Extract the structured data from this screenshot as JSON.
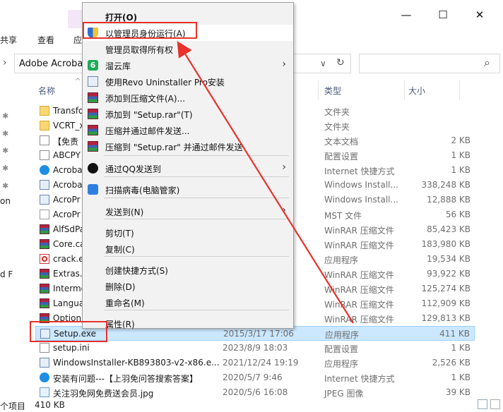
{
  "ribbon": {
    "tabs": [
      "共享",
      "查看",
      "应"
    ]
  },
  "window_controls": {
    "minimize": "—",
    "maximize": "☐",
    "close": "✕"
  },
  "address": {
    "path": "Adobe Acrobat",
    "dropdown": "∨",
    "refresh": "↻",
    "search_icon": "⌕"
  },
  "columns": {
    "name": "名称",
    "type": "类型",
    "size": "大小",
    "sort_arrow": "^"
  },
  "left_clipped": [
    "on",
    "d F"
  ],
  "files": [
    {
      "name": "Transfo",
      "date": "",
      "type": "文件夹",
      "size": "",
      "icon": "folder-icon"
    },
    {
      "name": "VCRT_x",
      "date": "",
      "type": "文件夹",
      "size": "",
      "icon": "folder-icon"
    },
    {
      "name": "【免责",
      "date": "",
      "type": "文本文档",
      "size": "2 KB",
      "icon": "text-file-icon"
    },
    {
      "name": "ABCPY",
      "date": "",
      "type": "配置设置",
      "size": "1 KB",
      "icon": "config-file-icon"
    },
    {
      "name": "Acroba",
      "date": "",
      "type": "Internet 快捷方式",
      "size": "1 KB",
      "icon": "internet-shortcut-icon"
    },
    {
      "name": "Acroba",
      "date": "",
      "type": "Windows Install...",
      "size": "338,248 KB",
      "icon": "installer-icon"
    },
    {
      "name": "AcroPr",
      "date": "",
      "type": "Windows Install...",
      "size": "12,888 KB",
      "icon": "installer-icon"
    },
    {
      "name": "AcroPr",
      "date": "",
      "type": "MST 文件",
      "size": "56 KB",
      "icon": "mst-file-icon"
    },
    {
      "name": "AlfSdPa",
      "date": "",
      "type": "WinRAR 压缩文件",
      "size": "85,423 KB",
      "icon": "winrar-icon"
    },
    {
      "name": "Core.ca",
      "date": "",
      "type": "WinRAR 压缩文件",
      "size": "183,980 KB",
      "icon": "winrar-icon"
    },
    {
      "name": "crack.e",
      "date": "",
      "type": "应用程序",
      "size": "19,534 KB",
      "icon": "pdf-app-icon"
    },
    {
      "name": "Extras.",
      "date": "",
      "type": "WinRAR 压缩文件",
      "size": "93,922 KB",
      "icon": "winrar-icon"
    },
    {
      "name": "Interme",
      "date": "",
      "type": "WinRAR 压缩文件",
      "size": "125,274 KB",
      "icon": "winrar-icon"
    },
    {
      "name": "Langua",
      "date": "",
      "type": "WinRAR 压缩文件",
      "size": "112,909 KB",
      "icon": "winrar-icon"
    },
    {
      "name": "Option",
      "date": "",
      "type": "WinRAR 压缩文件",
      "size": "129,813 KB",
      "icon": "winrar-icon"
    },
    {
      "name": "Setup.exe",
      "date": "2015/3/17 17:06",
      "type": "应用程序",
      "size": "411 KB",
      "icon": "setup-exe-icon"
    },
    {
      "name": "setup.ini",
      "date": "2023/8/9 18:03",
      "type": "配置设置",
      "size": "1 KB",
      "icon": "config-file-icon"
    },
    {
      "name": "WindowsInstaller-KB893803-v2-x86.e...",
      "date": "2021/12/24 19:19",
      "type": "应用程序",
      "size": "2,526 KB",
      "icon": "installer-app-icon"
    },
    {
      "name": "安装有问题---【上羽免问答搜索答案】",
      "date": "2020/5/7 9:46",
      "type": "Internet 快捷方式",
      "size": "1 KB",
      "icon": "internet-shortcut-icon"
    },
    {
      "name": "关注羽免网免费送会员.jpg",
      "date": "2020/5/6 16:08",
      "type": "JPEG 图像",
      "size": "39 KB",
      "icon": "jpeg-image-icon"
    }
  ],
  "status": {
    "count": "个项目",
    "selected": "410 KB"
  },
  "menu": {
    "items": [
      {
        "label": "打开(O)",
        "bold": true,
        "icon": "",
        "arrow": false
      },
      {
        "label": "以管理员身份运行(A)",
        "icon": "uac-shield-icon",
        "arrow": false,
        "highlight": true
      },
      {
        "label": "管理员取得所有权",
        "icon": "",
        "arrow": false
      },
      {
        "label": "溜云库",
        "icon": "liuyunku-icon",
        "glyph": "6",
        "arrow": true
      },
      {
        "label": "使用Revo Uninstaller Pro安装",
        "icon": "revo-uninstaller-icon",
        "arrow": false
      },
      {
        "label": "添加到压缩文件(A)...",
        "icon": "winrar-icon",
        "arrow": false
      },
      {
        "label": "添加到 \"Setup.rar\"(T)",
        "icon": "winrar-icon",
        "arrow": false
      },
      {
        "label": "压缩并通过邮件发送...",
        "icon": "winrar-icon",
        "arrow": false
      },
      {
        "label": "压缩到 \"Setup.rar\" 并通过邮件发送",
        "icon": "winrar-icon",
        "arrow": false
      },
      {
        "label": "通过QQ发送到",
        "icon": "qq-icon",
        "arrow": true
      },
      {
        "label": "扫描病毒(电脑管家)",
        "icon": "pc-manager-icon",
        "arrow": false
      },
      {
        "label": "发送到(N)",
        "icon": "",
        "arrow": true
      },
      {
        "label": "剪切(T)",
        "icon": "",
        "arrow": false
      },
      {
        "label": "复制(C)",
        "icon": "",
        "arrow": false
      },
      {
        "label": "创建快捷方式(S)",
        "icon": "",
        "arrow": false
      },
      {
        "label": "删除(D)",
        "icon": "",
        "arrow": false
      },
      {
        "label": "重命名(M)",
        "icon": "",
        "arrow": false
      },
      {
        "label": "属性(R)",
        "icon": "",
        "arrow": false
      }
    ],
    "submenu_arrow": "›"
  },
  "colors": {
    "annotation_red": "#e8322b",
    "selection_bg": "#cce8ff",
    "menu_bg": "#f2f2f2"
  }
}
